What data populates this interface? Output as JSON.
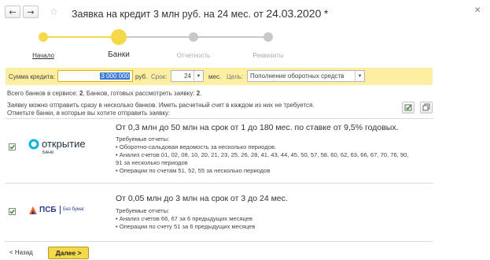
{
  "window": {
    "title": "Заявка на кредит 3 млн руб. на 24 мес. от",
    "title_date": "24.03.2020",
    "title_suffix": "*",
    "back_icon": "←",
    "forward_icon": "→",
    "star_icon": "☆",
    "close_icon": "✕"
  },
  "steps": [
    {
      "label": "Начало",
      "state": "done"
    },
    {
      "label": "Банки",
      "state": "current"
    },
    {
      "label": "Отчетность",
      "state": "todo"
    },
    {
      "label": "Реквизиты",
      "state": "todo"
    }
  ],
  "form": {
    "amount_label": "Сумма кредита:",
    "amount_value": "3 000 000",
    "currency": "руб.",
    "term_label": "Срок:",
    "term_value": "24",
    "term_unit": "мес.",
    "goal_label": "Цель:",
    "goal_value": "Пополнение оборотных средств"
  },
  "info": {
    "banks_total_label": "Всего банков в сервисе:",
    "banks_total": "2",
    "banks_ready_label": "Банков, готовых рассмотреть заявку:",
    "banks_ready": "2",
    "line1": "Заявку можно отправить сразу в несколько банков. Иметь расчетный счет в каждом из них не требуется.",
    "line2": "Отметьте банки, в которые вы хотите отправить заявку:"
  },
  "banks": [
    {
      "name": "открытие",
      "name_sub": "БАНК",
      "checked": true,
      "offer": "От 0,3 млн до 50 млн на срок от 1 до 180 мес. по ставке от 9,5% годовых.",
      "req_title": "Требуемые отчеты:",
      "reqs": [
        "• Оборотно-сальдовая ведомость за несколько периодов.",
        "• Анализ счетов 01, 02, 08, 10, 20, 21, 23, 25, 26, 28, 41, 43, 44, 45, 50, 57, 58, 60, 62, 63, 66, 67, 70, 76, 90,",
        "  91 за несколько периодов",
        "• Операции по счетам 51, 52, 55 за несколько периодов"
      ]
    },
    {
      "name": "ПСБ",
      "name_sub": "Без бумаг",
      "checked": true,
      "offer": "От 0,05 млн до 3 млн на срок от 3 до 24 мес.",
      "req_title": "Требуемые отчеты:",
      "reqs": [
        "• Анализ счетов 66, 67 за 6 предыдущих месяцев",
        "• Операции по счету 51 за 6 предыдущих месяцев"
      ]
    }
  ],
  "footer": {
    "back_label": "< Назад",
    "next_label": "Далее >"
  },
  "colors": {
    "accent": "#f5d94a",
    "band": "#fcefa1",
    "step_inactive": "#c8c8c8",
    "otkritie": "#00b3e3",
    "psb_blue": "#2b3a8f",
    "psb_orange": "#f26522"
  }
}
